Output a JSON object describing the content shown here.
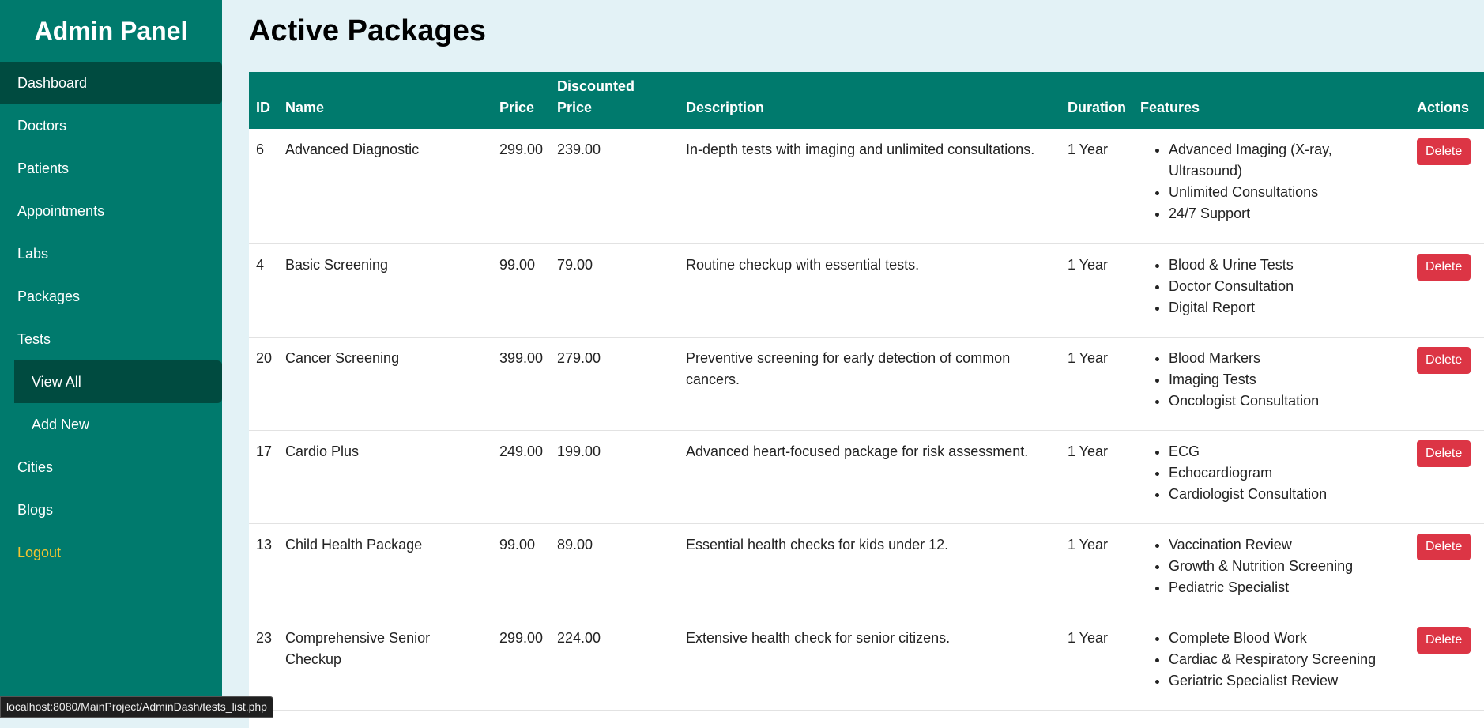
{
  "sidebar": {
    "title": "Admin Panel",
    "items": [
      {
        "label": "Dashboard",
        "active": true
      },
      {
        "label": "Doctors"
      },
      {
        "label": "Patients"
      },
      {
        "label": "Appointments"
      },
      {
        "label": "Labs"
      },
      {
        "label": "Packages"
      },
      {
        "label": "Tests"
      }
    ],
    "tests_sub": [
      {
        "label": "View All",
        "active": true
      },
      {
        "label": "Add New"
      }
    ],
    "after": [
      {
        "label": "Cities"
      },
      {
        "label": "Blogs"
      }
    ],
    "logout": "Logout"
  },
  "main": {
    "title": "Active Packages",
    "columns": [
      "ID",
      "Name",
      "Price",
      "Discounted Price",
      "Description",
      "Duration",
      "Features",
      "Actions"
    ],
    "delete_label": "Delete",
    "rows": [
      {
        "id": "6",
        "name": "Advanced Diagnostic",
        "price": "299.00",
        "discounted": "239.00",
        "description": "In-depth tests with imaging and unlimited consultations.",
        "duration": "1 Year",
        "features": [
          "Advanced Imaging (X-ray, Ultrasound)",
          "Unlimited Consultations",
          "24/7 Support"
        ]
      },
      {
        "id": "4",
        "name": "Basic Screening",
        "price": "99.00",
        "discounted": "79.00",
        "description": "Routine checkup with essential tests.",
        "duration": "1 Year",
        "features": [
          "Blood & Urine Tests",
          "Doctor Consultation",
          "Digital Report"
        ]
      },
      {
        "id": "20",
        "name": "Cancer Screening",
        "price": "399.00",
        "discounted": "279.00",
        "description": "Preventive screening for early detection of common cancers.",
        "duration": "1 Year",
        "features": [
          "Blood Markers",
          "Imaging Tests",
          "Oncologist Consultation"
        ]
      },
      {
        "id": "17",
        "name": "Cardio Plus",
        "price": "249.00",
        "discounted": "199.00",
        "description": "Advanced heart-focused package for risk assessment.",
        "duration": "1 Year",
        "features": [
          "ECG",
          "Echocardiogram",
          "Cardiologist Consultation"
        ]
      },
      {
        "id": "13",
        "name": "Child Health Package",
        "price": "99.00",
        "discounted": "89.00",
        "description": "Essential health checks for kids under 12.",
        "duration": "1 Year",
        "features": [
          "Vaccination Review",
          "Growth & Nutrition Screening",
          "Pediatric Specialist"
        ]
      },
      {
        "id": "23",
        "name": "Comprehensive Senior Checkup",
        "price": "299.00",
        "discounted": "224.00",
        "description": "Extensive health check for senior citizens.",
        "duration": "1 Year",
        "features": [
          "Complete Blood Work",
          "Cardiac & Respiratory Screening",
          "Geriatric Specialist Review"
        ]
      }
    ]
  },
  "statusbar": {
    "url": "localhost:8080/MainProject/AdminDash/tests_list.php"
  },
  "colors": {
    "sidebar": "#007a6d",
    "active": "#004b40",
    "header": "#007a6d",
    "danger": "#dc3545",
    "logout": "#f4c430",
    "page_bg": "#e3f2f6"
  }
}
